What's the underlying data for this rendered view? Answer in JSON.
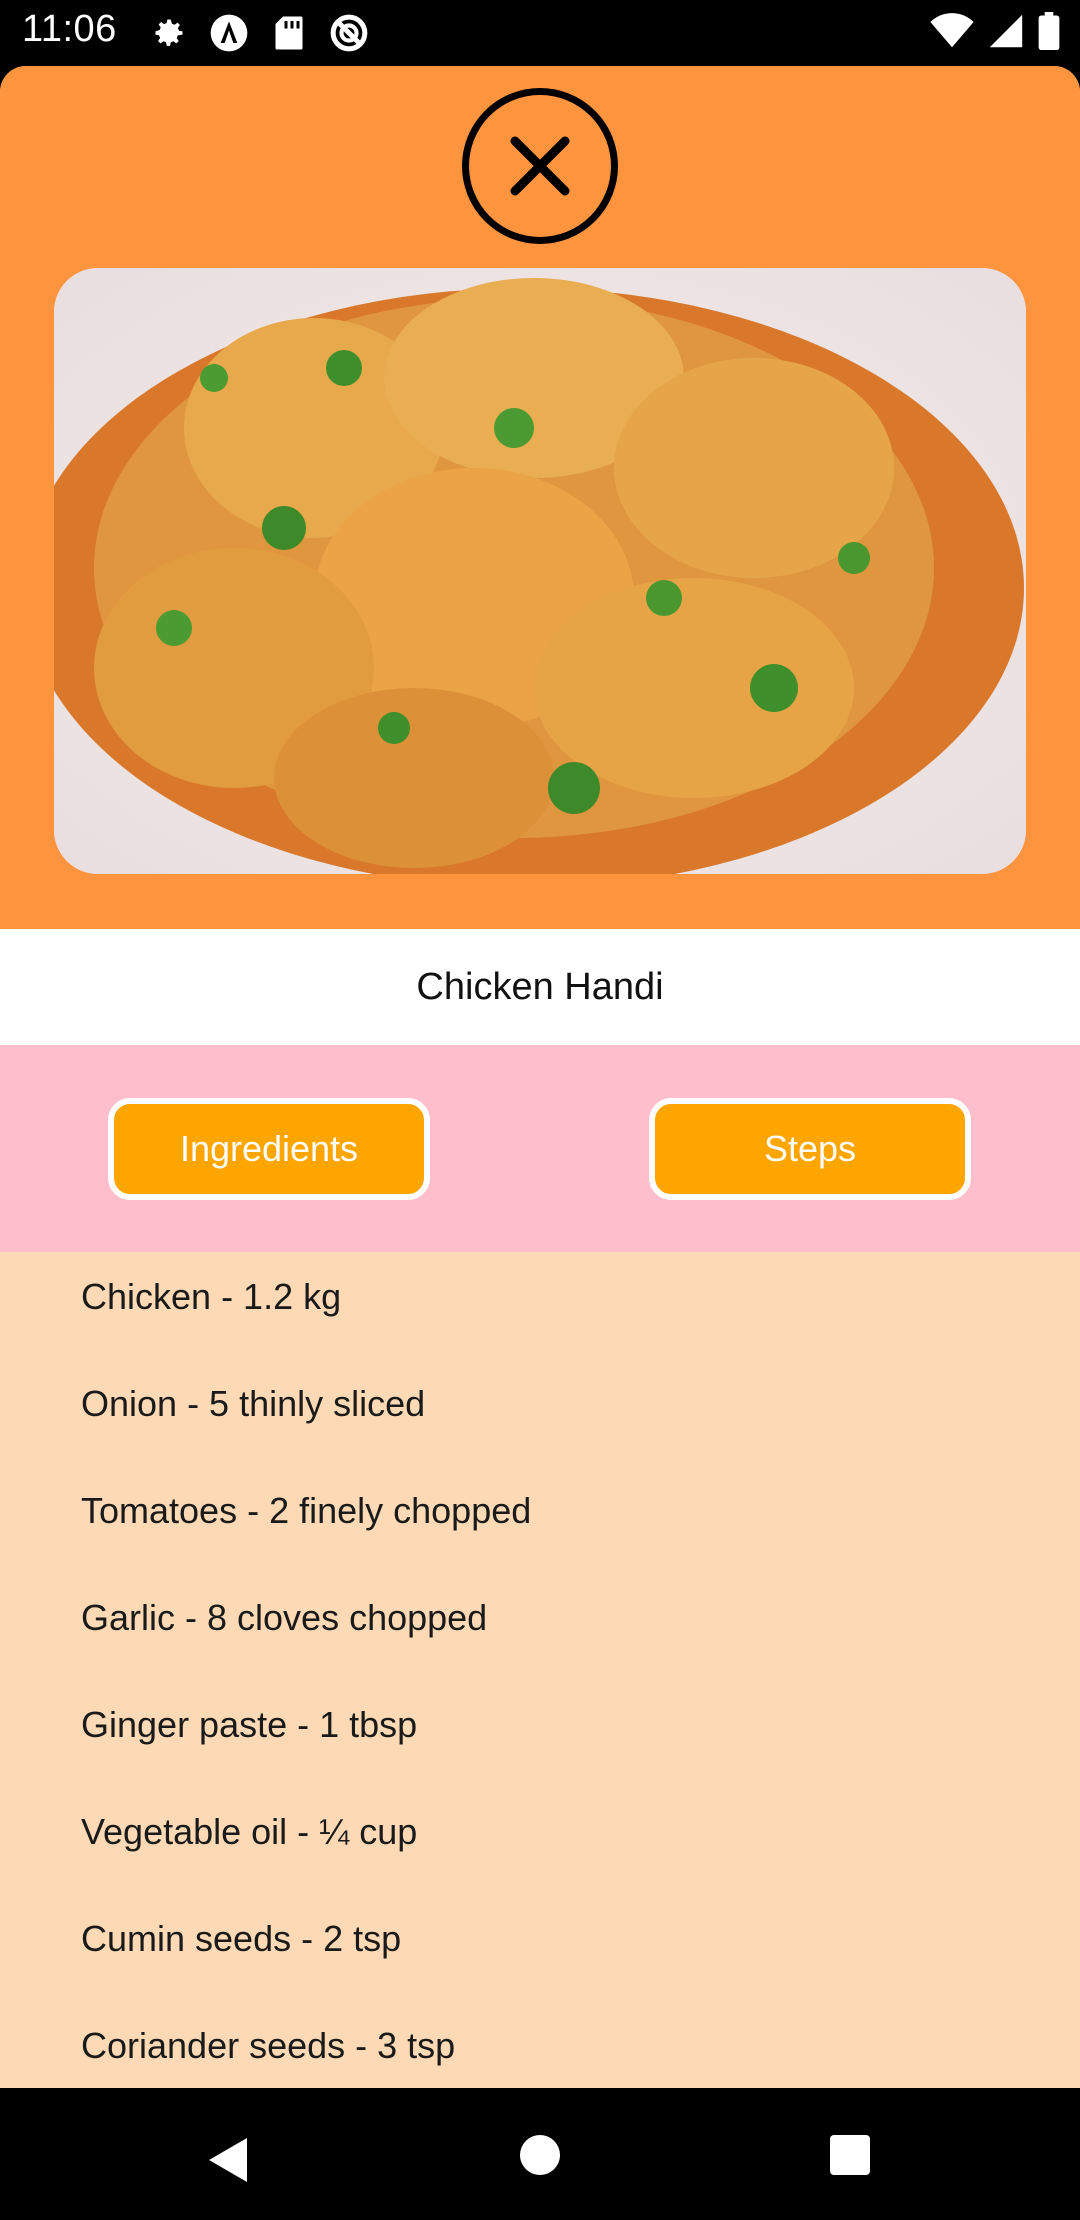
{
  "status_bar": {
    "time": "11:06",
    "left_icons": [
      "gear-icon",
      "a-circle-icon",
      "sd-card-icon",
      "blocked-circle-icon"
    ],
    "right_icons": [
      "wifi-icon",
      "signal-icon",
      "battery-icon"
    ]
  },
  "recipe": {
    "title": "Chicken Handi",
    "image": "chicken-handi-photo"
  },
  "tabs": {
    "ingredients_label": "Ingredients",
    "steps_label": "Steps"
  },
  "ingredients": [
    "Chicken - 1.2 kg",
    "Onion - 5 thinly sliced",
    "Tomatoes - 2 finely chopped",
    "Garlic - 8 cloves chopped",
    "Ginger paste - 1 tbsp",
    "Vegetable oil - ¼ cup",
    "Cumin seeds - 2 tsp",
    "Coriander seeds - 3 tsp"
  ],
  "colors": {
    "hero_bg": "#fe943e",
    "tab_band_bg": "#ffbecb",
    "tab_button_bg": "#ffa500",
    "list_bg": "#fddab5"
  }
}
